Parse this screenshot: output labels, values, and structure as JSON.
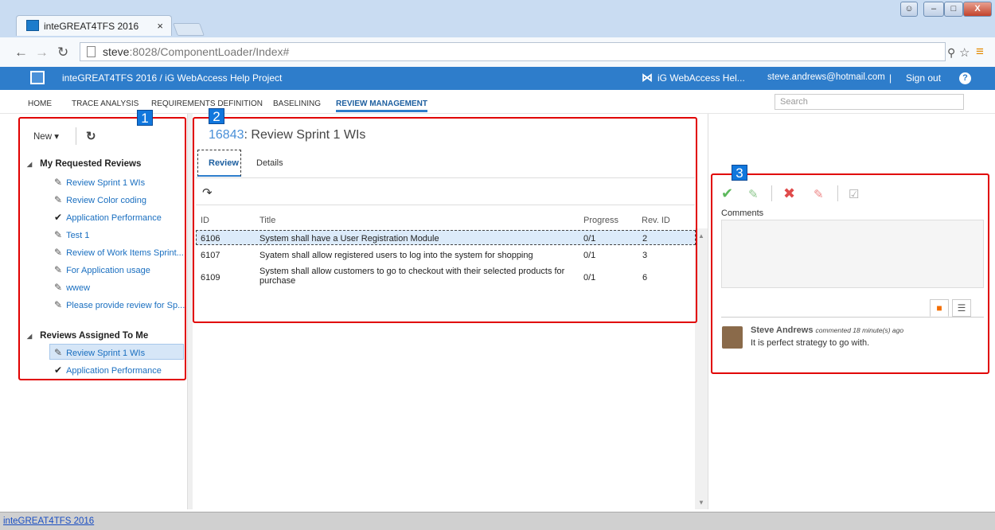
{
  "browser": {
    "tab_title": "inteGREAT4TFS 2016",
    "tab_close": "×",
    "url_host": "steve",
    "url_rest": ":8028/ComponentLoader/Index#"
  },
  "app": {
    "product": "inteGREAT4TFS 2016  /  iG WebAccess Help Project",
    "project_short": "iG WebAccess Hel...",
    "user": "steve.andrews@hotmail.com",
    "sep": "|",
    "sign_out": "Sign out",
    "help": "?"
  },
  "menu": {
    "items": [
      "HOME",
      "TRACE ANALYSIS",
      "REQUIREMENTS DEFINITION",
      "BASELINING",
      "REVIEW MANAGEMENT"
    ],
    "search_placeholder": "Search"
  },
  "left": {
    "new_label": "New ▾",
    "refresh_icon": "↻",
    "my_requested_header": "My Requested Reviews",
    "my_requested": [
      {
        "label": "Review Sprint 1 WIs",
        "icon": "edit-icon"
      },
      {
        "label": "Review Color coding",
        "icon": "edit-icon"
      },
      {
        "label": "Application Performance",
        "icon": "check-icon"
      },
      {
        "label": "Test 1",
        "icon": "edit-icon"
      },
      {
        "label": "Review of Work Items Sprint...",
        "icon": "edit-icon"
      },
      {
        "label": "For Application usage",
        "icon": "edit-icon"
      },
      {
        "label": "wwew",
        "icon": "edit-icon"
      },
      {
        "label": "Please provide review for Sp...",
        "icon": "edit-icon"
      }
    ],
    "assigned_header": "Reviews Assigned To Me",
    "assigned": [
      {
        "label": "Review Sprint 1 WIs",
        "icon": "edit-icon"
      },
      {
        "label": "Application Performance",
        "icon": "check-icon"
      }
    ]
  },
  "middle": {
    "review_id": "16843",
    "review_title": ": Review Sprint 1 WIs",
    "tabs": [
      "Review",
      "Details"
    ],
    "columns": [
      "ID",
      "Title",
      "Progress",
      "Rev. ID"
    ],
    "rows": [
      {
        "id": "6106",
        "title": "System shall have a User Registration Module",
        "progress": "0/1",
        "rev": "2"
      },
      {
        "id": "6107",
        "title": "Syatem shall allow registered users to log into the system for shopping",
        "progress": "0/1",
        "rev": "3"
      },
      {
        "id": "6109",
        "title": "System shall allow customers to go to checkout with their selected products for",
        "title2": "purchase",
        "progress": "0/1",
        "rev": "6"
      }
    ]
  },
  "right": {
    "comments_label": "Comments",
    "comment_author": "Steve Andrews",
    "comment_meta": "commented 18 minute(s) ago",
    "comment_text": "It is perfect strategy to go with."
  },
  "markers": [
    "1",
    "2",
    "3"
  ],
  "status_link": "inteGREAT4TFS 2016",
  "colors": {
    "accent": "#2e7dcb",
    "highlight": "#e10000",
    "marker": "#1177dd"
  }
}
